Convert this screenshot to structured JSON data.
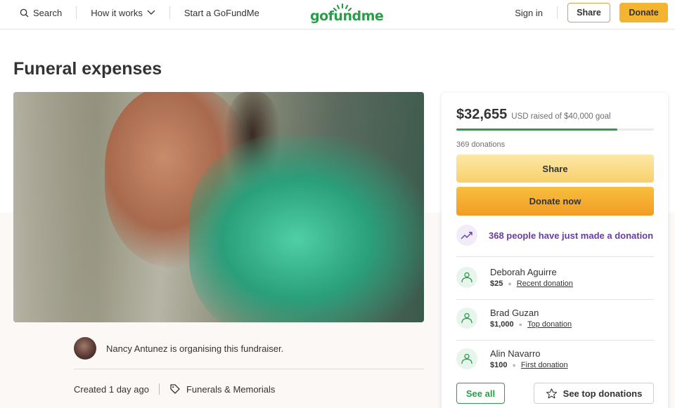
{
  "header": {
    "search_label": "Search",
    "how_it_works_label": "How it works",
    "start_label": "Start a GoFundMe",
    "logo_text": "gofundme",
    "signin_label": "Sign in",
    "share_label": "Share",
    "donate_label": "Donate"
  },
  "page": {
    "title": "Funeral expenses"
  },
  "organizer": {
    "text": "Nancy Antunez is organising this fundraiser.",
    "created": "Created 1 day ago",
    "category": "Funerals & Memorials"
  },
  "card": {
    "amount": "$32,655",
    "goal_text": "USD raised of $40,000 goal",
    "progress_fraction": 0.816,
    "donation_count": "369 donations",
    "share_label": "Share",
    "donate_label": "Donate now",
    "trend_text": "368 people have just made a donation",
    "donors": [
      {
        "name": "Deborah Aguirre",
        "amount": "$25",
        "tag": "Recent donation"
      },
      {
        "name": "Brad Guzan",
        "amount": "$1,000",
        "tag": "Top donation"
      },
      {
        "name": "Alin Navarro",
        "amount": "$100",
        "tag": "First donation"
      }
    ],
    "see_all_label": "See all",
    "see_top_label": "See top donations"
  },
  "colors": {
    "brand_green": "#2a9d4a",
    "donate_yellow": "#f2b431",
    "trend_purple": "#6a3aa8"
  }
}
